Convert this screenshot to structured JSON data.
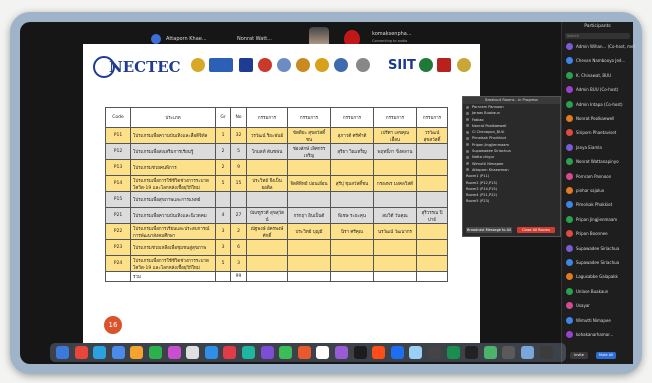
{
  "participants_strip": [
    {
      "name": "Attaporn Khae..."
    },
    {
      "name": "Nonrat Watt..."
    },
    {
      "name": ""
    },
    {
      "name": ""
    },
    {
      "name": "komaksenpha..."
    }
  ],
  "connecting_label": "Connecting to audio",
  "slide": {
    "org_logo_text": "NECTEC",
    "siit_logo_text": "SIIT",
    "page_number": "16",
    "table": {
      "headers": [
        "Code",
        "ประเภท",
        "Gr",
        "No",
        "กรรมการ",
        "กรรมการ",
        "กรรมการ",
        "กรรมการ",
        "กรรมการ"
      ],
      "rows": [
        {
          "style": "yel",
          "cells": [
            "P11",
            "โปรแกรมเพื่อความบันเทิงและสื่อดิจิทัล",
            "1",
            "32",
            "วรวัฒน์ ริยะพันธ์",
            "ขัตติยะ สุขสวัสดิ์ชน",
            "สุภาวดี ศรีคำดี",
            "เปรีศา เลขคุณเอื้อน",
            "วรวัฒน์ สุขสวัสดิ์"
          ]
        },
        {
          "style": "gry",
          "cells": [
            "P12",
            "โปรแกรมเพื่อส่งเสริมการเรียนรู้",
            "2",
            "5",
            "โกมลท์ ตันชฟน",
            "ช่องลักษ์ เลิศกรรเจริญ",
            "สุริยา วิณเทร็ญ",
            "พฤทธิ์ภา ขิ่งตลาน",
            ""
          ]
        },
        {
          "style": "yel",
          "cells": [
            "P13",
            "โปรแกรมช่วยคนพิการ",
            "2",
            "9",
            "",
            "",
            "",
            "",
            ""
          ]
        },
        {
          "style": "yel",
          "cells": [
            "P14",
            "โปรแกรมเพื่อการใช้ชีวิตช่วงการระบาดโควิด-19 และโลกหลังเชื้อยุวิถีใหม่",
            "5",
            "15",
            "ประวิทย์ จึงเป็นยอดิล",
            "จิตติทิทย์ ปอนเอี่อน",
            "สุรีปุ ชุมสวัสดิ์ชน",
            "กรองพร มงคลวิสดี",
            ""
          ]
        },
        {
          "style": "gry",
          "cells": [
            "P15",
            "โปรแกรมเพื่อสุขภาพและการแพทย์",
            "",
            "",
            "",
            "",
            "",
            "",
            ""
          ]
        },
        {
          "style": "gry",
          "cells": [
            "P21",
            "โปรแกรมเพื่อความบันเทิงและนิเวดคม",
            "4",
            "27",
            "บัณฑูรวดี สุขสุวัตน์",
            "กรกฤา อินเป็นดี",
            "พิเชษ ระยะคุน",
            "สมวิตี วันคุณ",
            "สุริวรรณ ปิปาธ์"
          ]
        },
        {
          "style": "yel",
          "cells": [
            "P22",
            "โปรแกรมเพื่อการเรียนและประสบการณ์การพัฒนาสังคมศึกษา",
            "3",
            "2",
            "ณัฐพงษ์ อัครพงษ์ศักดิ์",
            "ประวิทย์ บุญมี",
            "นิรา ศรีคุณ",
            "นรวัฒน์ วัฒนากร",
            ""
          ]
        },
        {
          "style": "yel",
          "cells": [
            "P23",
            "โปรแกรมช่วยเหลือเพื่อชุมชนสู่สุขภาพ",
            "3",
            "6",
            "",
            "",
            "",
            "",
            ""
          ]
        },
        {
          "style": "yel",
          "cells": [
            "P24",
            "โปรแกรมเพื่อการใช้ชีวิตช่วงการระบาดโควิด-19 และโลกหลังเชื้อยุวิถีใหม่",
            "5",
            "3",
            "",
            "",
            "",
            "",
            ""
          ]
        },
        {
          "style": "tot",
          "cells": [
            "",
            "รวม",
            "",
            "99",
            "",
            "",
            "",
            "",
            ""
          ]
        }
      ]
    }
  },
  "breakout_popup": {
    "title": "Breakout Rooms - In Progress",
    "people": [
      "Pornram Pannoon",
      "Jaraas Buakaun",
      "Fabiao",
      "Nonrat Poolkaewell",
      "Ci Chenapon_BUU",
      "Pimolsak Pharkkiot",
      "Pripan Jingjienmaam",
      "Supawadee Siriachua",
      "Natta chigur",
      "Wimutti Nimapee",
      "Attaporn Khaewman"
    ],
    "rooms": [
      "Room1 (P11)",
      "Room2 (P12,P13)",
      "Room3 (P14,P15)",
      "Room4 (P21,P22)",
      "Room5 (P23)"
    ],
    "broadcast_label": "Broadcast Message to All",
    "close_label": "Close All Rooms"
  },
  "participants_panel": {
    "title": "Participants",
    "search_placeholder": "Search",
    "people": [
      {
        "name": "Admin Wihan... (Co-host, me)",
        "color": "#7b5ad6"
      },
      {
        "name": "Chevan Nambooya Jed...",
        "color": "#3d86e8"
      },
      {
        "name": "K. Chinawat, BUU",
        "color": "#2aa14f"
      },
      {
        "name": "Admin BUU (Co-host)",
        "color": "#9c40d0"
      },
      {
        "name": "Admin Intapa (Co-host)",
        "color": "#2aa14f"
      },
      {
        "name": "Nonrat Poolkaewell",
        "color": "#e07b1f"
      },
      {
        "name": "Siriporn Phaetaviset",
        "color": "#e04a3f"
      },
      {
        "name": "Janya Eiamla",
        "color": "#7b5ad6"
      },
      {
        "name": "Nonrat Wattanapinyo",
        "color": "#2aa14f"
      },
      {
        "name": "Pornram Pannoon",
        "color": "#d64a8f"
      },
      {
        "name": "pinhar sajalux",
        "color": "#e07b1f"
      },
      {
        "name": "Pimolsak Phakkiot",
        "color": "#3d86e8"
      },
      {
        "name": "Pripan Jingjienmaam",
        "color": "#2aa14f"
      },
      {
        "name": "Pripan Boonnee",
        "color": "#e04a3f"
      },
      {
        "name": "Supawadee Siriachua",
        "color": "#7b5ad6"
      },
      {
        "name": "Supawadee Siriachua",
        "color": "#3d86e8"
      },
      {
        "name": "Lagusabbe Galapakk",
        "color": "#e07b1f"
      },
      {
        "name": "Unlase Buakaun",
        "color": "#2aa14f"
      },
      {
        "name": "Usayar",
        "color": "#d64a8f"
      },
      {
        "name": "Wimutti Nimapee",
        "color": "#3d86e8"
      },
      {
        "name": "kohakanarhamar...",
        "color": "#9c40d0"
      }
    ],
    "invite_label": "Invite",
    "mute_all_label": "Mute All"
  }
}
